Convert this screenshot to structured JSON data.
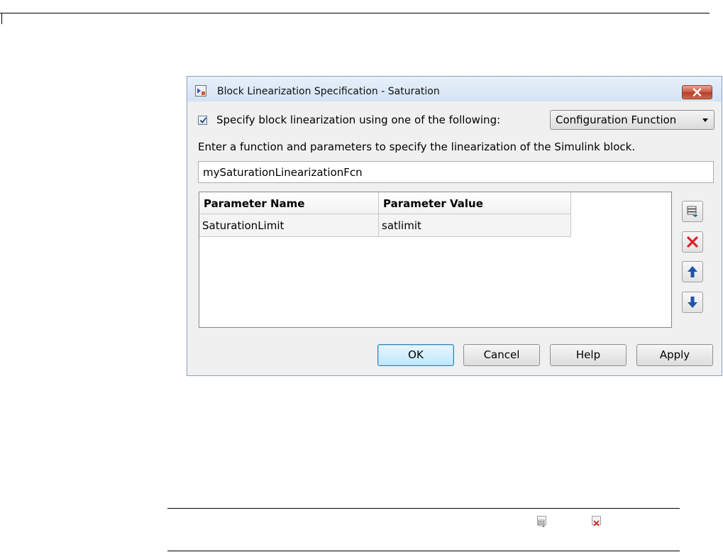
{
  "dialog": {
    "title": "Block Linearization Specification - Saturation",
    "specify_checked": true,
    "specify_label": "Specify block linearization using one of the following:",
    "method_selected": "Configuration Function",
    "instructions": "Enter a function and parameters to specify the linearization of the Simulink block.",
    "function_name": "mySaturationLinearizationFcn",
    "table": {
      "columns": [
        "Parameter Name",
        "Parameter Value"
      ],
      "rows": [
        [
          "SaturationLimit",
          "satlimit"
        ]
      ]
    },
    "side_buttons": [
      "add-row-icon",
      "delete-row-icon",
      "move-up-icon",
      "move-down-icon"
    ],
    "buttons": {
      "ok": "OK",
      "cancel": "Cancel",
      "help": "Help",
      "apply": "Apply"
    }
  },
  "colors": {
    "frame": "#dbe8f6",
    "delete_red": "#d9242b",
    "arrow_blue": "#1f55a8"
  }
}
